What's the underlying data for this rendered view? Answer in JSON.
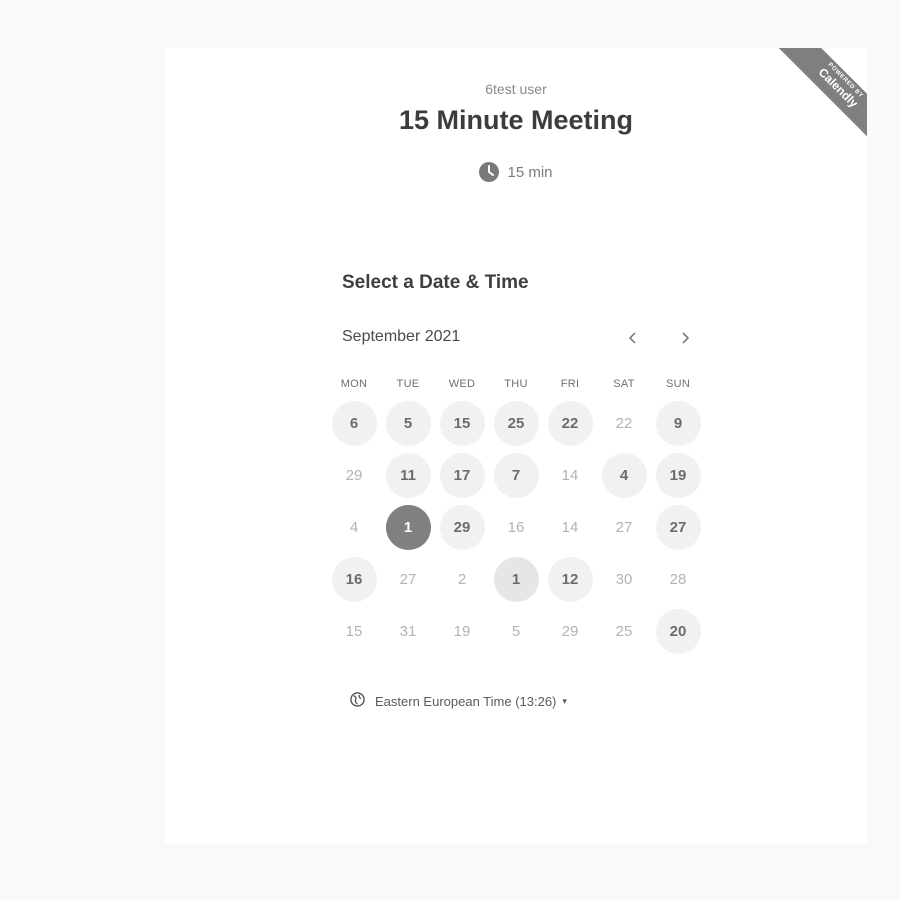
{
  "badge": {
    "powered": "POWERED BY",
    "brand": "Calendly"
  },
  "header": {
    "host": "6test user",
    "title": "15 Minute Meeting",
    "duration": "15 min",
    "duration_icon": "clock-icon"
  },
  "picker": {
    "section_title": "Select a Date & Time",
    "month": "September 2021",
    "prev_icon": "chevron-left-icon",
    "next_icon": "chevron-right-icon",
    "weekdays": [
      "MON",
      "TUE",
      "WED",
      "THU",
      "FRI",
      "SAT",
      "SUN"
    ],
    "weeks": [
      [
        {
          "d": "6",
          "s": "available"
        },
        {
          "d": "5",
          "s": "available"
        },
        {
          "d": "15",
          "s": "available"
        },
        {
          "d": "25",
          "s": "available"
        },
        {
          "d": "22",
          "s": "available"
        },
        {
          "d": "22",
          "s": "unavailable"
        },
        {
          "d": "9",
          "s": "available"
        }
      ],
      [
        {
          "d": "29",
          "s": "unavailable"
        },
        {
          "d": "11",
          "s": "available"
        },
        {
          "d": "17",
          "s": "available"
        },
        {
          "d": "7",
          "s": "available"
        },
        {
          "d": "14",
          "s": "unavailable"
        },
        {
          "d": "4",
          "s": "available"
        },
        {
          "d": "19",
          "s": "available"
        }
      ],
      [
        {
          "d": "4",
          "s": "unavailable"
        },
        {
          "d": "1",
          "s": "selected"
        },
        {
          "d": "29",
          "s": "available"
        },
        {
          "d": "16",
          "s": "unavailable"
        },
        {
          "d": "14",
          "s": "unavailable"
        },
        {
          "d": "27",
          "s": "unavailable"
        },
        {
          "d": "27",
          "s": "available"
        }
      ],
      [
        {
          "d": "16",
          "s": "available"
        },
        {
          "d": "27",
          "s": "unavailable"
        },
        {
          "d": "2",
          "s": "unavailable"
        },
        {
          "d": "1",
          "s": "today"
        },
        {
          "d": "12",
          "s": "available"
        },
        {
          "d": "30",
          "s": "unavailable"
        },
        {
          "d": "28",
          "s": "unavailable"
        }
      ],
      [
        {
          "d": "15",
          "s": "unavailable"
        },
        {
          "d": "31",
          "s": "unavailable"
        },
        {
          "d": "19",
          "s": "unavailable"
        },
        {
          "d": "5",
          "s": "unavailable"
        },
        {
          "d": "29",
          "s": "unavailable"
        },
        {
          "d": "25",
          "s": "unavailable"
        },
        {
          "d": "20",
          "s": "available"
        }
      ]
    ]
  },
  "timezone": {
    "label": "Eastern European Time (13:26)",
    "icon": "globe-icon",
    "caret": "▾"
  },
  "colors": {
    "selected": "#808080",
    "available_bg": "#f1f1f1",
    "badge": "#7f7f7f"
  }
}
